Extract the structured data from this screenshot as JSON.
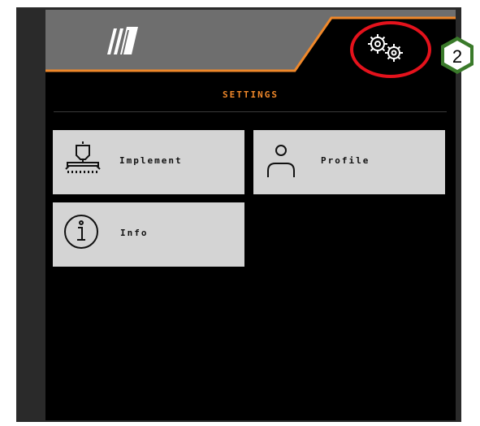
{
  "header": {
    "logo_icon": "implement-logo-icon",
    "settings_icon": "gears-icon"
  },
  "page": {
    "title": "SETTINGS"
  },
  "tiles": [
    {
      "label": "Implement",
      "icon": "seed-drill-icon"
    },
    {
      "label": "Profile",
      "icon": "user-icon"
    },
    {
      "label": "Info",
      "icon": "info-icon"
    }
  ],
  "annotation": {
    "number": "2",
    "ring_color": "#e4121c",
    "badge_color": "#3a7a2a"
  },
  "colors": {
    "accent": "#f0882a",
    "header_bg": "#6e6e6e",
    "tile_bg": "#d4d4d4"
  }
}
